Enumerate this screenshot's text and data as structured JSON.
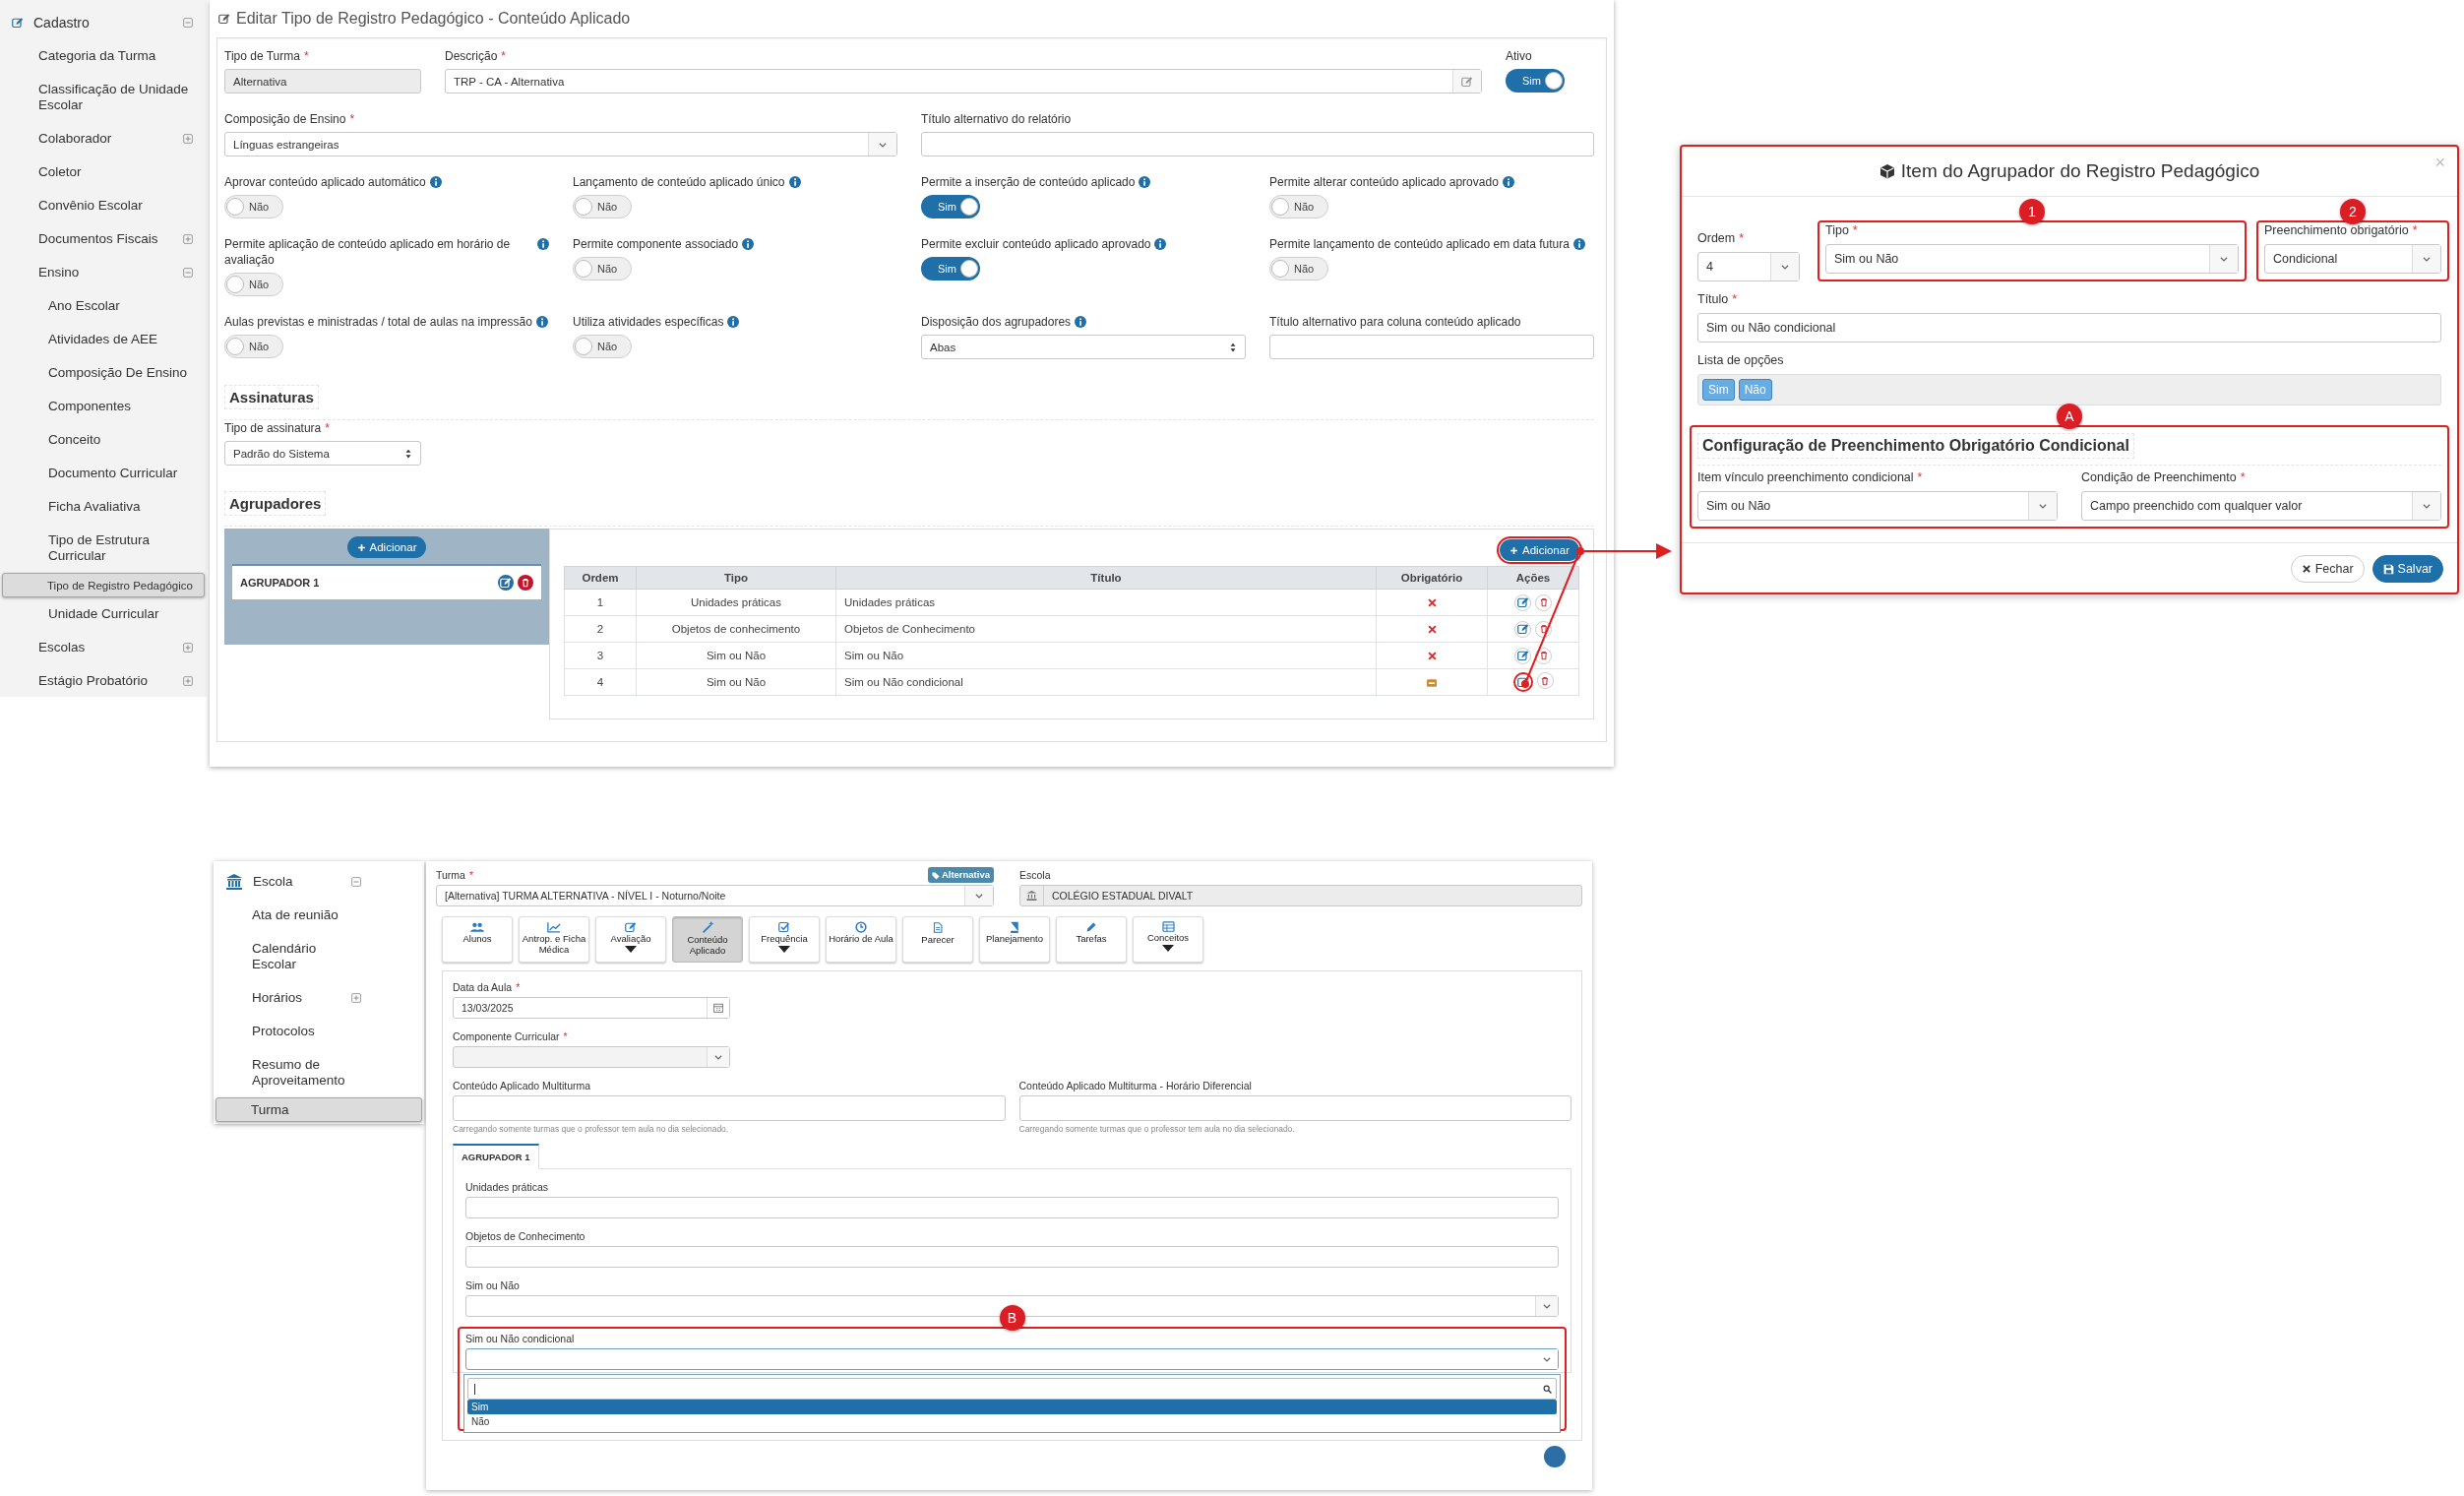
{
  "admin_sidebar": {
    "items": [
      {
        "label": "Cadastro",
        "selected": false,
        "expanded": true,
        "children": [
          {
            "label": "Categoria da Turma",
            "selected": false
          },
          {
            "label": "Classificação de Unidade Escolar",
            "selected": false
          },
          {
            "label": "Colaborador",
            "selected": false,
            "expanded": false
          },
          {
            "label": "Coletor",
            "selected": false
          },
          {
            "label": "Convênio Escolar",
            "selected": false
          },
          {
            "label": "Documentos Fiscais",
            "selected": false,
            "expanded": false
          },
          {
            "label": "Ensino",
            "selected": false,
            "expanded": true,
            "children": [
              {
                "label": "Ano Escolar",
                "selected": false
              },
              {
                "label": "Atividades de AEE",
                "selected": false
              },
              {
                "label": "Composição De Ensino",
                "selected": false
              },
              {
                "label": "Componentes",
                "selected": false
              },
              {
                "label": "Conceito",
                "selected": false
              },
              {
                "label": "Documento Curricular",
                "selected": false
              },
              {
                "label": "Ficha Avaliativa",
                "selected": false
              },
              {
                "label": "Tipo de Estrutura Curricular",
                "selected": false
              },
              {
                "label": "Tipo de Registro Pedagógico",
                "selected": true
              },
              {
                "label": "Unidade Curricular",
                "selected": false
              }
            ]
          },
          {
            "label": "Escolas",
            "selected": false,
            "expanded": false
          },
          {
            "label": "Estágio Probatório",
            "selected": false,
            "expanded": false
          }
        ]
      }
    ]
  },
  "form": {
    "title": "Editar Tipo de Registro Pedagógico - Conteúdo Aplicado",
    "header_fields": [
      {
        "kind": "readonly",
        "label": "Tipo de Turma",
        "required_mark": "*",
        "info": false,
        "value": "Alternativa"
      },
      {
        "kind": "editable",
        "label": "Descrição",
        "required_mark": "*",
        "info": false,
        "value": "TRP - CA - Alternativa"
      },
      {
        "kind": "toggle",
        "label": "Ativo",
        "info": false,
        "on": true,
        "value": "Sim"
      }
    ],
    "report_fields": [
      {
        "kind": "select",
        "label": "Composição de Ensino",
        "required_mark": "*",
        "info": false,
        "value": "Línguas estrangeiras"
      },
      {
        "kind": "text",
        "label": "Título alternativo do relatório",
        "info": false
      }
    ],
    "rows": [
      [
        {
          "kind": "toggle",
          "label": "Aprovar conteúdo aplicado automático",
          "info": true,
          "on": false,
          "value": "Não"
        },
        {
          "kind": "toggle",
          "label": "Lançamento de conteúdo aplicado único",
          "info": true,
          "on": false,
          "value": "Não"
        },
        {
          "kind": "toggle",
          "label": "Permite a inserção de conteúdo aplicado",
          "info": true,
          "on": true,
          "value": "Sim"
        },
        {
          "kind": "toggle",
          "label": "Permite alterar conteúdo aplicado aprovado",
          "info": true,
          "on": false,
          "value": "Não"
        }
      ],
      [
        {
          "kind": "toggle",
          "label": "Permite aplicação de conteúdo aplicado em horário de avaliação",
          "info": true,
          "on": false,
          "value": "Não"
        },
        {
          "kind": "toggle",
          "label": "Permite componente associado",
          "info": true,
          "on": false,
          "value": "Não"
        },
        {
          "kind": "toggle",
          "label": "Permite excluir conteúdo aplicado aprovado",
          "info": true,
          "on": true,
          "value": "Sim"
        },
        {
          "kind": "toggle",
          "label": "Permite lançamento de conteúdo aplicado em data futura",
          "info": true,
          "on": false,
          "value": "Não"
        }
      ],
      [
        {
          "kind": "toggle",
          "label": "Aulas previstas e ministradas / total de aulas na impressão",
          "info": true,
          "on": false,
          "value": "Não"
        },
        {
          "kind": "toggle",
          "label": "Utiliza atividades específicas",
          "info": true,
          "on": false,
          "value": "Não"
        },
        {
          "kind": "native_select",
          "label": "Disposição dos agrupadores",
          "info": true,
          "value": "Abas"
        },
        {
          "kind": "text",
          "label": "Título alternativo para coluna conteúdo aplicado",
          "info": false
        }
      ]
    ],
    "signatures": {
      "heading": "Assinaturas",
      "field": {
        "kind": "native_select",
        "label": "Tipo de assinatura",
        "required_mark": "*",
        "info": false,
        "value": "Padrão do Sistema"
      }
    },
    "groupers": {
      "heading": "Agrupadores",
      "add_button": {
        "label": "Adicionar",
        "highlighted": false
      },
      "groups": [
        {
          "label": "AGRUPADOR 1",
          "selected": true
        }
      ],
      "table_add_button": {
        "label": "Adicionar",
        "highlighted": true
      },
      "columns": [
        "Ordem",
        "Tipo",
        "Título",
        "Obrigatório",
        "Ações"
      ],
      "rows": [
        {
          "order": "1",
          "type": "Unidades práticas",
          "title": "Unidades práticas",
          "conditional": false,
          "edit_highlighted": false
        },
        {
          "order": "2",
          "type": "Objetos de conhecimento",
          "title": "Objetos de Conhecimento",
          "conditional": false,
          "edit_highlighted": false
        },
        {
          "order": "3",
          "type": "Sim ou Não",
          "title": "Sim ou Não",
          "conditional": false,
          "edit_highlighted": false
        },
        {
          "order": "4",
          "type": "Sim ou Não",
          "title": "Sim ou Não condicional",
          "conditional": true,
          "edit_highlighted": true
        }
      ]
    }
  },
  "dialog": {
    "title": "Item do Agrupador do Registro Pedagógico",
    "close": "×",
    "row1": [
      {
        "label": "Ordem",
        "required_mark": "*",
        "value": "4"
      },
      {
        "label": "Tipo",
        "required_mark": "*",
        "value": "Sim ou Não",
        "marker": "1"
      },
      {
        "label": "Preenchimento obrigatório",
        "required_mark": "*",
        "value": "Condicional",
        "marker": "2"
      }
    ],
    "title_field": {
      "label": "Título",
      "required_mark": "*",
      "value": "Sim ou Não condicional"
    },
    "options": {
      "label": "Lista de opções",
      "tags": [
        "Sim",
        "Não"
      ]
    },
    "conditional": {
      "marker": "A",
      "heading": "Configuração de Preenchimento Obrigatório Condicional",
      "fields": [
        {
          "label": "Item vínculo preenchimento condicional",
          "required_mark": "*",
          "value": "Sim ou Não"
        },
        {
          "label": "Condição de Preenchimento",
          "required_mark": "*",
          "value": "Campo preenchido com qualquer valor"
        }
      ]
    },
    "buttons": [
      {
        "kind": "close",
        "label": "Fechar"
      },
      {
        "kind": "save",
        "label": "Salvar"
      }
    ]
  },
  "class_page": {
    "sidebar": {
      "title": "Escola",
      "expanded": true,
      "items": [
        {
          "label": "Ata de reunião",
          "selected": false
        },
        {
          "label": "Calendário Escolar",
          "selected": false
        },
        {
          "label": "Horários",
          "selected": false,
          "expanded": false
        },
        {
          "label": "Protocolos",
          "selected": false
        },
        {
          "label": "Resumo de Aproveitamento",
          "selected": false
        },
        {
          "label": "Turma",
          "selected": true
        }
      ]
    },
    "turma": {
      "label": "Turma",
      "required_mark": "*",
      "badge": "Alternativa",
      "value": "[Alternativa] TURMA ALTERNATIVA - NÍVEL I - Noturno/Noite"
    },
    "escola": {
      "label": "Escola",
      "value": "COLÉGIO ESTADUAL DIVALT"
    },
    "toolbar": [
      {
        "label": "Alunos",
        "kind": "users",
        "selected": false,
        "dropdown": false
      },
      {
        "label": "Antrop. e Ficha Médica",
        "kind": "chart",
        "selected": false,
        "dropdown": false
      },
      {
        "label": "Avaliação",
        "kind": "edit",
        "selected": false,
        "dropdown": true
      },
      {
        "label": "Conteúdo Aplicado",
        "kind": "wand",
        "selected": true,
        "dropdown": false
      },
      {
        "label": "Frequência",
        "kind": "check",
        "selected": false,
        "dropdown": true
      },
      {
        "label": "Horário de Aula",
        "kind": "clock",
        "selected": false,
        "dropdown": false
      },
      {
        "label": "Parecer",
        "kind": "file",
        "selected": false,
        "dropdown": false
      },
      {
        "label": "Planejamento",
        "kind": "book",
        "selected": false,
        "dropdown": false
      },
      {
        "label": "Tarefas",
        "kind": "pencil",
        "selected": false,
        "dropdown": false
      },
      {
        "label": "Conceitos",
        "kind": "table",
        "selected": false,
        "dropdown": true
      }
    ],
    "date": {
      "label": "Data da Aula",
      "required_mark": "*",
      "value": "13/03/2025"
    },
    "component": {
      "label": "Componente Curricular",
      "required_mark": "*",
      "disabled": true
    },
    "multi": [
      {
        "label": "Conteúdo Aplicado Multiturma",
        "help": "Carregando somente turmas que o professor tem aula no dia selecionado."
      },
      {
        "label": "Conteúdo Aplicado Multiturma - Horário Diferencial",
        "help": "Carregando somente turmas que o professor tem aula no dia selecionado."
      }
    ],
    "tabs": [
      {
        "label": "AGRUPADOR 1",
        "selected": true
      }
    ],
    "group_fields": [
      {
        "kind": "text",
        "label": "Unidades práticas"
      },
      {
        "kind": "text",
        "label": "Objetos de Conhecimento"
      },
      {
        "kind": "select",
        "label": "Sim ou Não"
      },
      {
        "kind": "open_select",
        "label": "Sim ou Não condicional",
        "marker": "B",
        "options": [
          {
            "label": "Sim",
            "selected": true
          },
          {
            "label": "Não",
            "selected": false
          }
        ]
      }
    ]
  }
}
